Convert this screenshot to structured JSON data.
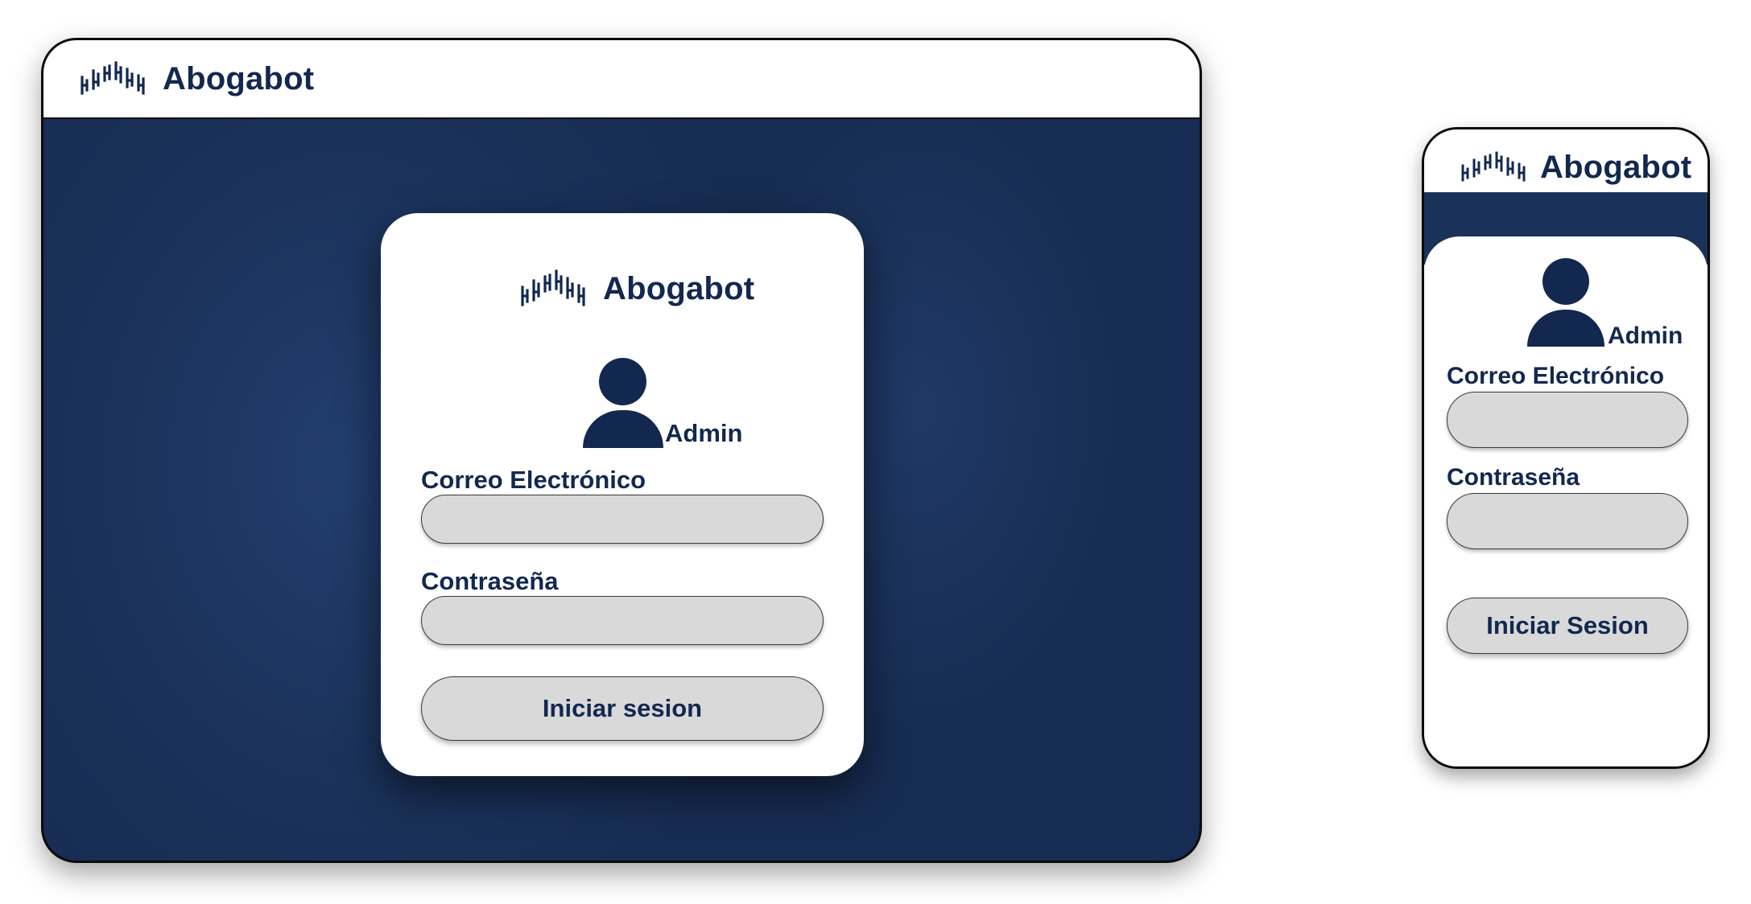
{
  "brand": {
    "name": "Abogabot",
    "color": "#13284f",
    "logo_icon": "sound-wave-bars-icon"
  },
  "theme": {
    "primary": "#1a3159",
    "input_bg": "#d9d9d9",
    "surface": "#ffffff"
  },
  "desktop": {
    "login": {
      "role": "Admin",
      "email_label": "Correo Electrónico",
      "email_value": "",
      "password_label": "Contraseña",
      "password_value": "",
      "submit_label": "Iniciar sesion"
    }
  },
  "mobile": {
    "login": {
      "role": "Admin",
      "email_label": "Correo Electrónico",
      "email_value": "",
      "password_label": "Contraseña",
      "password_value": "",
      "submit_label": "Iniciar Sesion"
    }
  }
}
